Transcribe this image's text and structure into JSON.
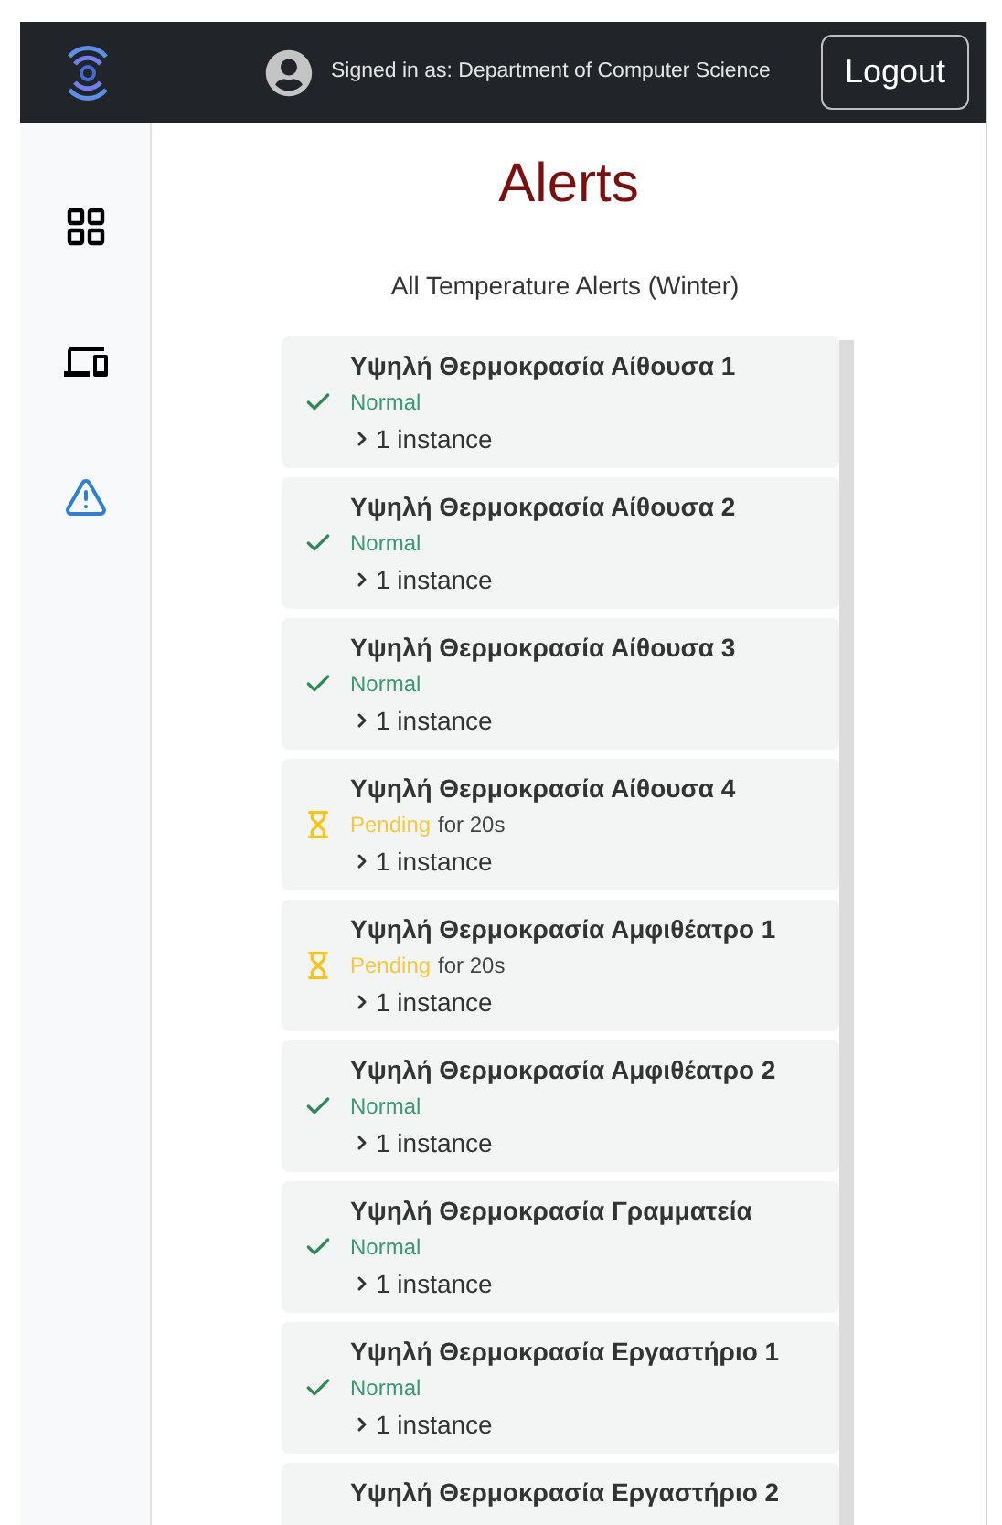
{
  "header": {
    "signed_in": "Signed in as: Department of Computer Science",
    "logout": "Logout"
  },
  "sidebar": {
    "items": [
      {
        "kind": "grid",
        "selected": false
      },
      {
        "kind": "devices",
        "selected": false
      },
      {
        "kind": "alerts",
        "selected": true
      }
    ]
  },
  "page": {
    "title": "Alerts",
    "subtitle": "All Temperature Alerts (Winter)"
  },
  "alerts": [
    {
      "title": "Υψηλή Θερμοκρασία Αίθουσα 1",
      "kind": "normal",
      "status": "Normal",
      "instances": "1 instance"
    },
    {
      "title": "Υψηλή Θερμοκρασία Αίθουσα 2",
      "kind": "normal",
      "status": "Normal",
      "instances": "1 instance"
    },
    {
      "title": "Υψηλή Θερμοκρασία Αίθουσα 3",
      "kind": "normal",
      "status": "Normal",
      "instances": "1 instance"
    },
    {
      "title": "Υψηλή Θερμοκρασία Αίθουσα 4",
      "kind": "pending",
      "status": "Pending",
      "duration": "for 20s",
      "instances": "1 instance"
    },
    {
      "title": "Υψηλή Θερμοκρασία Αμφιθέατρο 1",
      "kind": "pending",
      "status": "Pending",
      "duration": "for 20s",
      "instances": "1 instance"
    },
    {
      "title": "Υψηλή Θερμοκρασία Αμφιθέατρο 2",
      "kind": "normal",
      "status": "Normal",
      "instances": "1 instance"
    },
    {
      "title": "Υψηλή Θερμοκρασία Γραμματεία",
      "kind": "normal",
      "status": "Normal",
      "instances": "1 instance"
    },
    {
      "title": "Υψηλή Θερμοκρασία Εργαστήριο 1",
      "kind": "normal",
      "status": "Normal",
      "instances": "1 instance"
    },
    {
      "title": "Υψηλή Θερμοκρασία Εργαστήριο 2"
    }
  ]
}
